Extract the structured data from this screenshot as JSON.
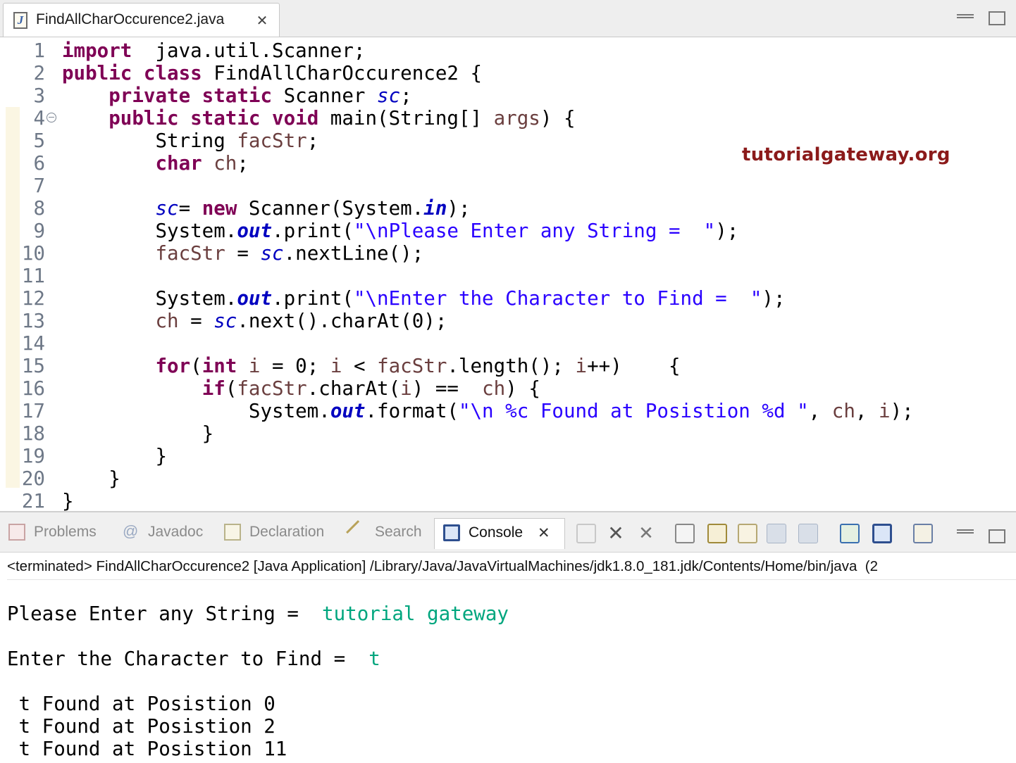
{
  "editor_tab": {
    "icon": "java-file-icon",
    "icon_letter": "J",
    "filename": "FindAllCharOccurence2.java",
    "close_glyph": "✕"
  },
  "code_lines": [
    {
      "n": "1",
      "segs": [
        [
          "kw",
          "import"
        ],
        [
          "",
          "  java.util.Scanner;"
        ]
      ]
    },
    {
      "n": "2",
      "segs": [
        [
          "kw",
          "public class"
        ],
        [
          "",
          " FindAllCharOccurence2 {"
        ]
      ]
    },
    {
      "n": "3",
      "segs": [
        [
          "",
          "    "
        ],
        [
          "kw",
          "private static"
        ],
        [
          "",
          " Scanner "
        ],
        [
          "fld",
          "sc"
        ],
        [
          "",
          ";"
        ]
      ]
    },
    {
      "n": "4",
      "fold": true,
      "segs": [
        [
          "",
          "    "
        ],
        [
          "kw",
          "public static void"
        ],
        [
          "",
          " main(String[] "
        ],
        [
          "var",
          "args"
        ],
        [
          "",
          ") {"
        ]
      ]
    },
    {
      "n": "5",
      "segs": [
        [
          "",
          "        String "
        ],
        [
          "var",
          "facStr"
        ],
        [
          "",
          ";"
        ]
      ]
    },
    {
      "n": "6",
      "segs": [
        [
          "",
          "        "
        ],
        [
          "kw",
          "char"
        ],
        [
          "var",
          " ch"
        ],
        [
          "",
          ";"
        ]
      ]
    },
    {
      "n": "7",
      "segs": []
    },
    {
      "n": "8",
      "segs": [
        [
          "",
          "        "
        ],
        [
          "fld",
          "sc"
        ],
        [
          "",
          "= "
        ],
        [
          "kw",
          "new"
        ],
        [
          "",
          " Scanner(System."
        ],
        [
          "sfld",
          "in"
        ],
        [
          "",
          ");"
        ]
      ]
    },
    {
      "n": "9",
      "segs": [
        [
          "",
          "        System."
        ],
        [
          "sfld",
          "out"
        ],
        [
          "",
          ".print("
        ],
        [
          "str",
          "\"\\nPlease Enter any String =  \""
        ],
        [
          "",
          ");"
        ]
      ]
    },
    {
      "n": "10",
      "segs": [
        [
          "",
          "        "
        ],
        [
          "var",
          "facStr"
        ],
        [
          "",
          " = "
        ],
        [
          "fld",
          "sc"
        ],
        [
          "",
          ".nextLine();"
        ]
      ]
    },
    {
      "n": "11",
      "segs": []
    },
    {
      "n": "12",
      "segs": [
        [
          "",
          "        System."
        ],
        [
          "sfld",
          "out"
        ],
        [
          "",
          ".print("
        ],
        [
          "str",
          "\"\\nEnter the Character to Find =  \""
        ],
        [
          "",
          ");"
        ]
      ]
    },
    {
      "n": "13",
      "segs": [
        [
          "",
          "        "
        ],
        [
          "var",
          "ch"
        ],
        [
          "",
          " = "
        ],
        [
          "fld",
          "sc"
        ],
        [
          "",
          ".next().charAt(0);"
        ]
      ]
    },
    {
      "n": "14",
      "segs": []
    },
    {
      "n": "15",
      "segs": [
        [
          "",
          "        "
        ],
        [
          "kw",
          "for"
        ],
        [
          "",
          "("
        ],
        [
          "kw",
          "int"
        ],
        [
          "var",
          " i"
        ],
        [
          "",
          " = 0; "
        ],
        [
          "var",
          "i"
        ],
        [
          "",
          " < "
        ],
        [
          "var",
          "facStr"
        ],
        [
          "",
          ".length(); "
        ],
        [
          "var",
          "i"
        ],
        [
          "",
          "++)    {"
        ]
      ]
    },
    {
      "n": "16",
      "segs": [
        [
          "",
          "            "
        ],
        [
          "kw",
          "if"
        ],
        [
          "",
          "("
        ],
        [
          "var",
          "facStr"
        ],
        [
          "",
          ".charAt("
        ],
        [
          "var",
          "i"
        ],
        [
          "",
          ") ==  "
        ],
        [
          "var",
          "ch"
        ],
        [
          "",
          ") {"
        ]
      ]
    },
    {
      "n": "17",
      "segs": [
        [
          "",
          "                System."
        ],
        [
          "sfld",
          "out"
        ],
        [
          "",
          ".format("
        ],
        [
          "str",
          "\"\\n %c Found at Posistion %d \""
        ],
        [
          "",
          ", "
        ],
        [
          "var",
          "ch"
        ],
        [
          "",
          ", "
        ],
        [
          "var",
          "i"
        ],
        [
          "",
          ");"
        ]
      ]
    },
    {
      "n": "18",
      "segs": [
        [
          "",
          "            }"
        ]
      ]
    },
    {
      "n": "19",
      "segs": [
        [
          "",
          "        }"
        ]
      ]
    },
    {
      "n": "20",
      "segs": [
        [
          "",
          "    }"
        ]
      ]
    },
    {
      "n": "21",
      "segs": [
        [
          "",
          "}"
        ]
      ]
    }
  ],
  "watermark": "tutorialgateway.org",
  "view_tabs": [
    {
      "label": "Problems",
      "icon": "problems-icon"
    },
    {
      "label": "Javadoc",
      "icon": "at-icon",
      "glyph": "@"
    },
    {
      "label": "Declaration",
      "icon": "declaration-icon"
    },
    {
      "label": "Search",
      "icon": "search-icon"
    },
    {
      "label": "Console",
      "icon": "console-icon",
      "active": true
    }
  ],
  "console": {
    "status": "<terminated> FindAllCharOccurence2 [Java Application] /Library/Java/JavaVirtualMachines/jdk1.8.0_181.jdk/Contents/Home/bin/java  (2",
    "lines": [
      {
        "text": "Please Enter any String =  ",
        "input": "tutorial gateway"
      },
      {
        "text": "Enter the Character to Find =  ",
        "input": "t"
      },
      {
        "text": " t Found at Posistion 0"
      },
      {
        "text": " t Found at Posistion 2"
      },
      {
        "text": " t Found at Posistion 11"
      }
    ]
  }
}
